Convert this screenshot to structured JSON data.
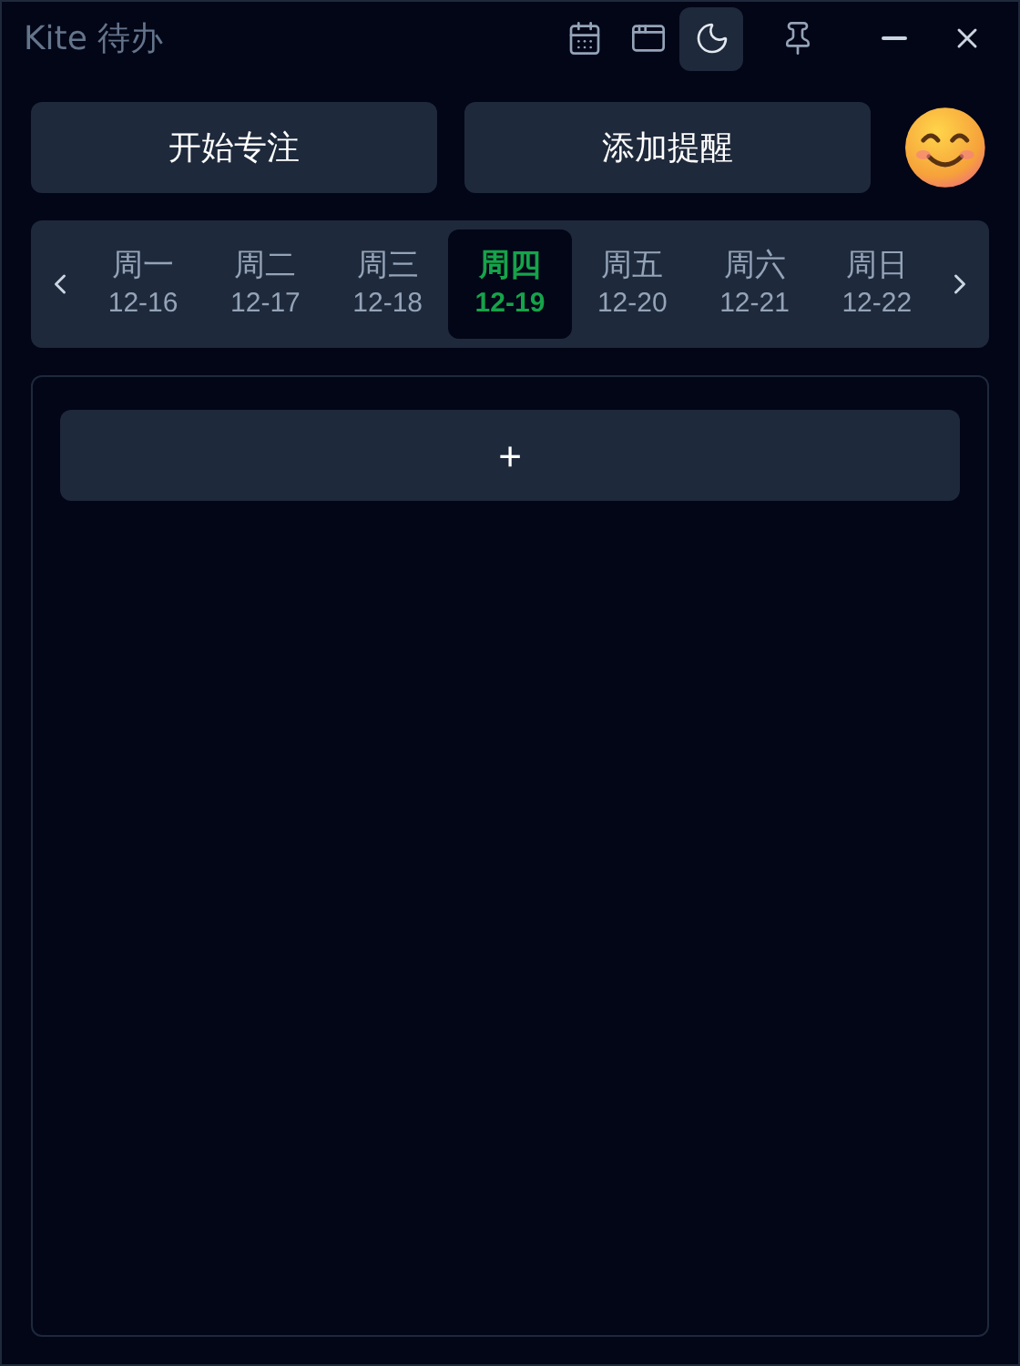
{
  "window": {
    "title": "Kite 待办"
  },
  "toolbar": [
    {
      "kind": "calendar",
      "on": false
    },
    {
      "kind": "window",
      "on": false
    },
    {
      "kind": "moon",
      "on": true
    },
    {
      "kind": "pin",
      "on": false
    }
  ],
  "actions": [
    "开始专注",
    "添加提醒"
  ],
  "week": {
    "days": [
      {
        "day": "周一",
        "date": "12-16",
        "selected": false
      },
      {
        "day": "周二",
        "date": "12-17",
        "selected": false
      },
      {
        "day": "周三",
        "date": "12-18",
        "selected": false
      },
      {
        "day": "周四",
        "date": "12-19",
        "selected": true
      },
      {
        "day": "周五",
        "date": "12-20",
        "selected": false
      },
      {
        "day": "周六",
        "date": "12-21",
        "selected": false
      },
      {
        "day": "周日",
        "date": "12-22",
        "selected": false
      }
    ]
  },
  "add_button": "+"
}
